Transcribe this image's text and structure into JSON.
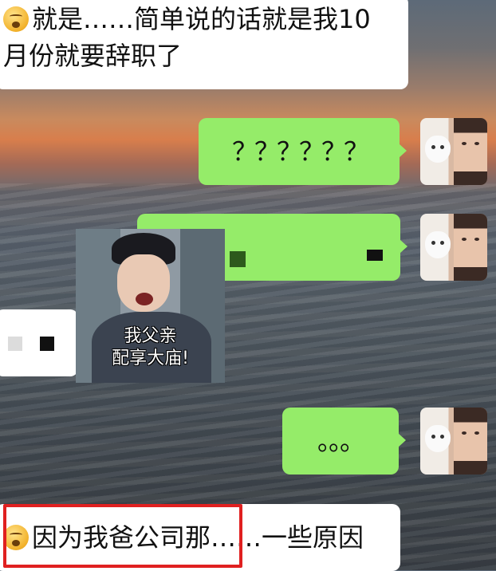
{
  "messages": {
    "m1_line1": "就是……简单说的话就是我10",
    "m1_line2": "月份就要辞职了",
    "m2_text": "？？？？？？",
    "m5_text": "。。。",
    "m6_text": "因为我爸公司那……一些原因"
  },
  "sticker": {
    "caption_line1": "我父亲",
    "caption_line2": "配享大庙!"
  },
  "emoji": {
    "name": "thinking-face-icon"
  },
  "colors": {
    "incoming_bubble": "#ffffff",
    "outgoing_bubble": "#95ec69",
    "highlight_box": "#e02020"
  }
}
